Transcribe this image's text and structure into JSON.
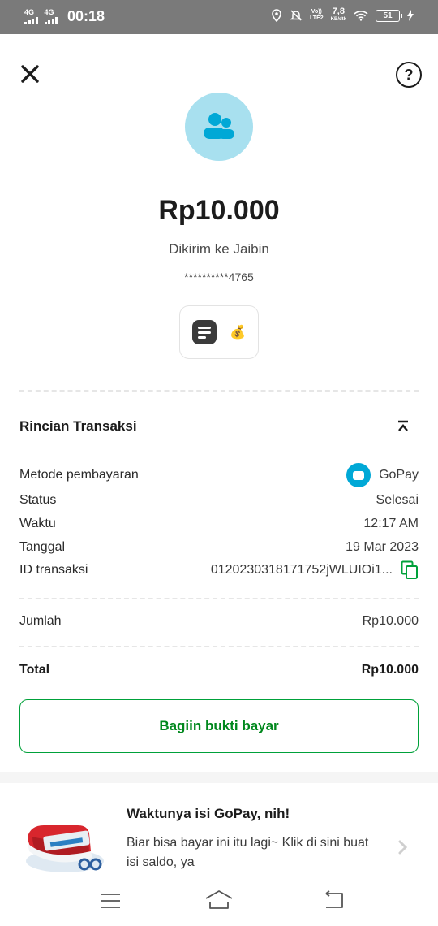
{
  "status_bar": {
    "sim1": "4G",
    "sim2": "4G",
    "time": "00:18",
    "volte_top": "Vo))",
    "volte_bottom": "LTE2",
    "speed_value": "7,8",
    "speed_unit": "KB/dtk",
    "battery": "51"
  },
  "header": {
    "close_icon": "close-icon",
    "help_icon": "help-icon",
    "help_symbol": "?"
  },
  "transfer": {
    "amount": "Rp10.000",
    "sent_to": "Dikirim ke Jaibin",
    "account": "**********4765",
    "note_icon": "document-icon",
    "note_emoji": "💰",
    "avatar_color": "#a8e0ef",
    "avatar_icon_color": "#00a8d6"
  },
  "details": {
    "title": "Rincian Transaksi",
    "rows": [
      {
        "label": "Metode pembayaran",
        "value": "GoPay"
      },
      {
        "label": "Status",
        "value": "Selesai"
      },
      {
        "label": "Waktu",
        "value": "12:17 AM"
      },
      {
        "label": "Tanggal",
        "value": "19 Mar 2023"
      },
      {
        "label": "ID transaksi",
        "value": "0120230318171752jWLUIOi1..."
      }
    ],
    "jumlah_label": "Jumlah",
    "jumlah_value": "Rp10.000",
    "total_label": "Total",
    "total_value": "Rp10.000"
  },
  "share_button": {
    "label": "Bagiin bukti bayar",
    "color": "#00881d"
  },
  "promo": {
    "title": "Waktunya isi GoPay, nih!",
    "text": "Biar bisa bayar ini itu lagi~ Klik di sini buat isi saldo, ya"
  },
  "nav": {
    "menu_icon": "menu-icon",
    "home_icon": "home-icon",
    "back_icon": "back-icon"
  }
}
